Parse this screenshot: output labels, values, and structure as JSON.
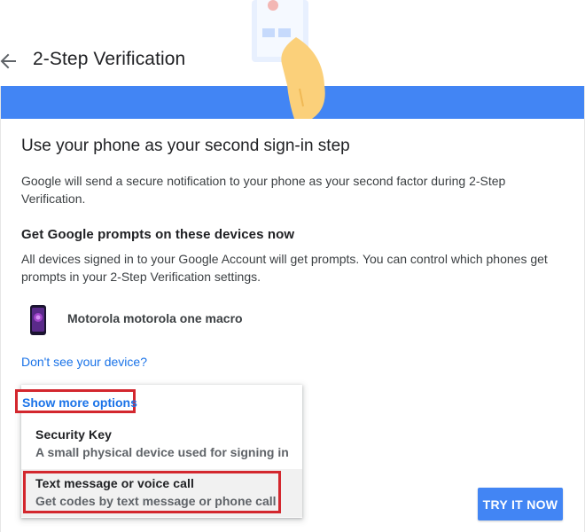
{
  "header": {
    "title": "2-Step Verification",
    "back_icon": "arrow-left-icon"
  },
  "colors": {
    "accent": "#4285f4",
    "link": "#1a73e8",
    "highlight": "#d3272e"
  },
  "card": {
    "heading": "Use your phone as your second sign-in step",
    "description": "Google will send a secure notification to your phone as your second factor during 2-Step Verification.",
    "prompts_heading": "Get Google prompts on these devices now",
    "prompts_description": "All devices signed in to your Google Account will get prompts. You can control which phones get prompts in your 2-Step Verification settings.",
    "device": {
      "name": "Motorola motorola one macro",
      "icon": "phone-icon"
    },
    "missing_device_link": "Don't see your device?",
    "more_options_label": "Show more options",
    "options": [
      {
        "title": "Security Key",
        "subtitle": "A small physical device used for signing in"
      },
      {
        "title": "Text message or voice call",
        "subtitle": "Get codes by text message or phone call"
      }
    ],
    "try_button": "TRY IT NOW"
  }
}
